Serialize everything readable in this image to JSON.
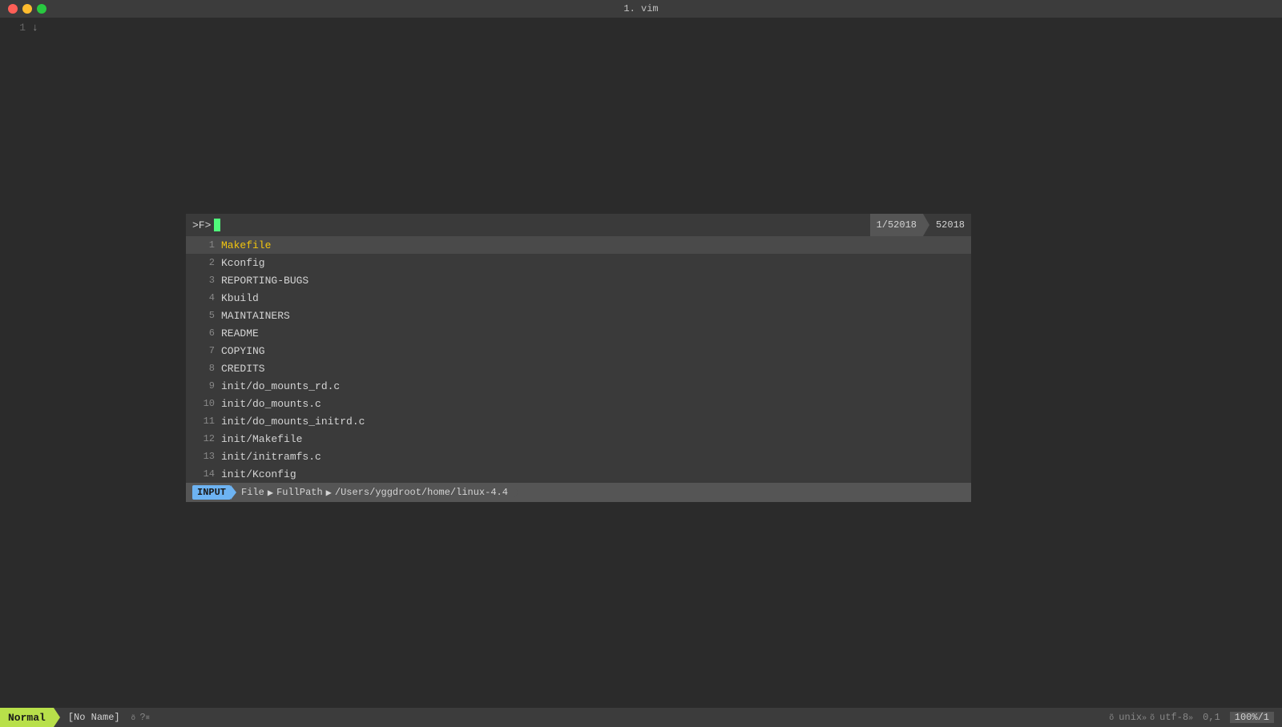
{
  "titlebar": {
    "title": "1. vim"
  },
  "window_controls": {
    "close_label": "close",
    "min_label": "minimize",
    "max_label": "maximize"
  },
  "editor": {
    "line_number": "1",
    "cursor_char": "↓"
  },
  "fzf": {
    "prompt": ">F>",
    "cursor_visible": true,
    "counter_current": "1/52018",
    "counter_total": "52018",
    "items": [
      {
        "num": "1",
        "name": "Makefile",
        "selected": true
      },
      {
        "num": "2",
        "name": "Kconfig",
        "selected": false
      },
      {
        "num": "3",
        "name": "REPORTING-BUGS",
        "selected": false
      },
      {
        "num": "4",
        "name": "Kbuild",
        "selected": false
      },
      {
        "num": "5",
        "name": "MAINTAINERS",
        "selected": false
      },
      {
        "num": "6",
        "name": "README",
        "selected": false
      },
      {
        "num": "7",
        "name": "COPYING",
        "selected": false
      },
      {
        "num": "8",
        "name": "CREDITS",
        "selected": false
      },
      {
        "num": "9",
        "name": "init/do_mounts_rd.c",
        "selected": false
      },
      {
        "num": "10",
        "name": "init/do_mounts.c",
        "selected": false
      },
      {
        "num": "11",
        "name": "init/do_mounts_initrd.c",
        "selected": false
      },
      {
        "num": "12",
        "name": "init/Makefile",
        "selected": false
      },
      {
        "num": "13",
        "name": "init/initramfs.c",
        "selected": false
      },
      {
        "num": "14",
        "name": "init/Kconfig",
        "selected": false
      }
    ],
    "statusbar": {
      "mode": "INPUT",
      "breadcrumb1": "File",
      "breadcrumb2": "FullPath",
      "path": "/Users/yggdroot/home/linux-4.4"
    }
  },
  "statusbar": {
    "mode": "Normal",
    "filename": "[No Name]",
    "flags": "?",
    "encoding_unix": "unix",
    "encoding_utf8": "utf-8",
    "position": "0,1",
    "percent": "100%/1"
  },
  "tilde_lines": [
    "~",
    "~",
    "~",
    "~",
    "~",
    "~",
    "~",
    "~",
    "~",
    "~",
    "~",
    "~",
    "~",
    "~",
    "~",
    "~",
    "~",
    "~",
    "~"
  ]
}
